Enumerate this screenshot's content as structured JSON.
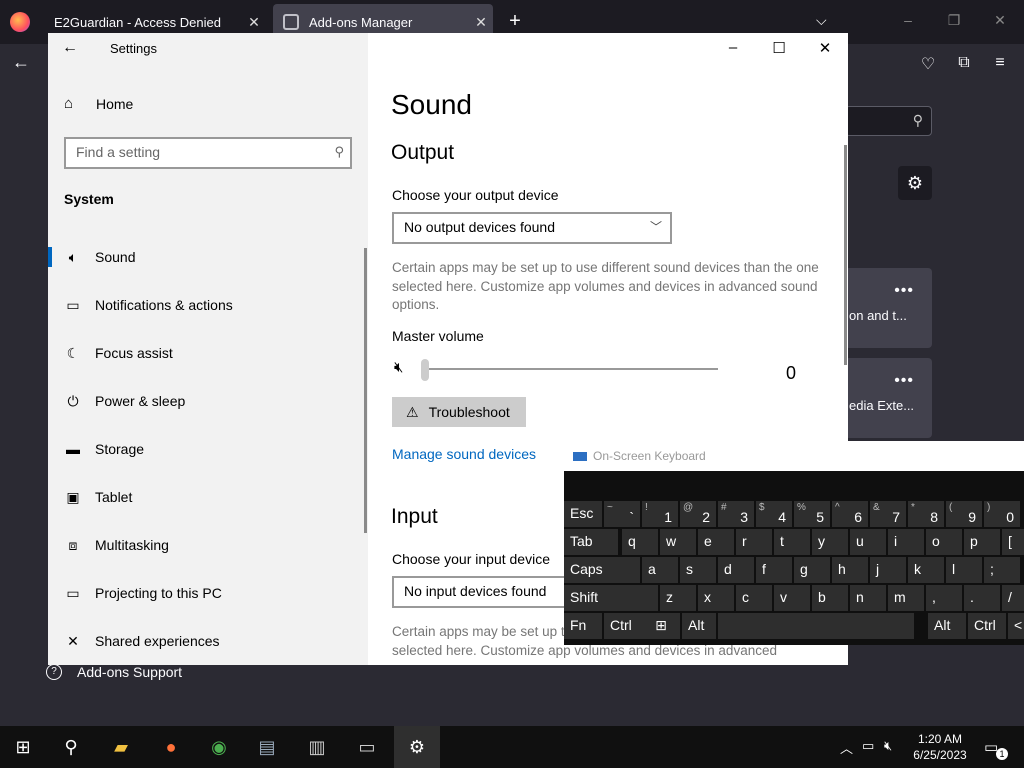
{
  "firefox": {
    "tabs": [
      {
        "label": "E2Guardian - Access Denied"
      },
      {
        "label": "Add-ons Manager"
      }
    ],
    "new_tab": "+",
    "cards": [
      {
        "text": "on and t..."
      },
      {
        "text": "edia Exte..."
      }
    ],
    "support": "Add-ons Support"
  },
  "settings": {
    "title": "Settings",
    "home": "Home",
    "search_placeholder": "Find a setting",
    "section": "System",
    "nav": [
      {
        "label": "Sound",
        "icon": "speaker-icon"
      },
      {
        "label": "Notifications & actions",
        "icon": "notification-icon"
      },
      {
        "label": "Focus assist",
        "icon": "moon-icon"
      },
      {
        "label": "Power & sleep",
        "icon": "power-icon"
      },
      {
        "label": "Storage",
        "icon": "storage-icon"
      },
      {
        "label": "Tablet",
        "icon": "tablet-icon"
      },
      {
        "label": "Multitasking",
        "icon": "multitasking-icon"
      },
      {
        "label": "Projecting to this PC",
        "icon": "projector-icon"
      },
      {
        "label": "Shared experiences",
        "icon": "shared-icon"
      }
    ],
    "page_title": "Sound",
    "output": {
      "heading": "Output",
      "device_label": "Choose your output device",
      "device_value": "No output devices found",
      "description": "Certain apps may be set up to use different sound devices than the one selected here. Customize app volumes and devices in advanced sound options.",
      "volume_label": "Master volume",
      "volume_value": "0",
      "troubleshoot": "Troubleshoot",
      "manage_link": "Manage sound devices"
    },
    "input": {
      "heading": "Input",
      "device_label": "Choose your input device",
      "device_value": "No input devices found",
      "description": "Certain apps may be set up to use different sound devices than the one selected here. Customize app volumes and devices in advanced"
    }
  },
  "keyboard": {
    "title": "On-Screen Keyboard",
    "row1": [
      {
        "m": "Esc",
        "s": ""
      },
      {
        "m": "`",
        "s": "~"
      },
      {
        "m": "1",
        "s": "!"
      },
      {
        "m": "2",
        "s": "@"
      },
      {
        "m": "3",
        "s": "#"
      },
      {
        "m": "4",
        "s": "$"
      },
      {
        "m": "5",
        "s": "%"
      },
      {
        "m": "6",
        "s": "^"
      },
      {
        "m": "7",
        "s": "&"
      },
      {
        "m": "8",
        "s": "*"
      },
      {
        "m": "9",
        "s": "("
      },
      {
        "m": "0",
        "s": ")"
      }
    ],
    "row2": [
      "Tab",
      "q",
      "w",
      "e",
      "r",
      "t",
      "y",
      "u",
      "i",
      "o",
      "p",
      "["
    ],
    "row3": [
      "Caps",
      "a",
      "s",
      "d",
      "f",
      "g",
      "h",
      "j",
      "k",
      "l",
      ";"
    ],
    "row4": [
      "Shift",
      "z",
      "x",
      "c",
      "v",
      "b",
      "n",
      "m",
      ",",
      ".",
      "/"
    ],
    "row5": [
      "Fn",
      "Ctrl",
      "Alt",
      "",
      "Alt",
      "Ctrl",
      "<"
    ]
  },
  "taskbar": {
    "time": "1:20 AM",
    "date": "6/25/2023",
    "notification_count": "1"
  }
}
